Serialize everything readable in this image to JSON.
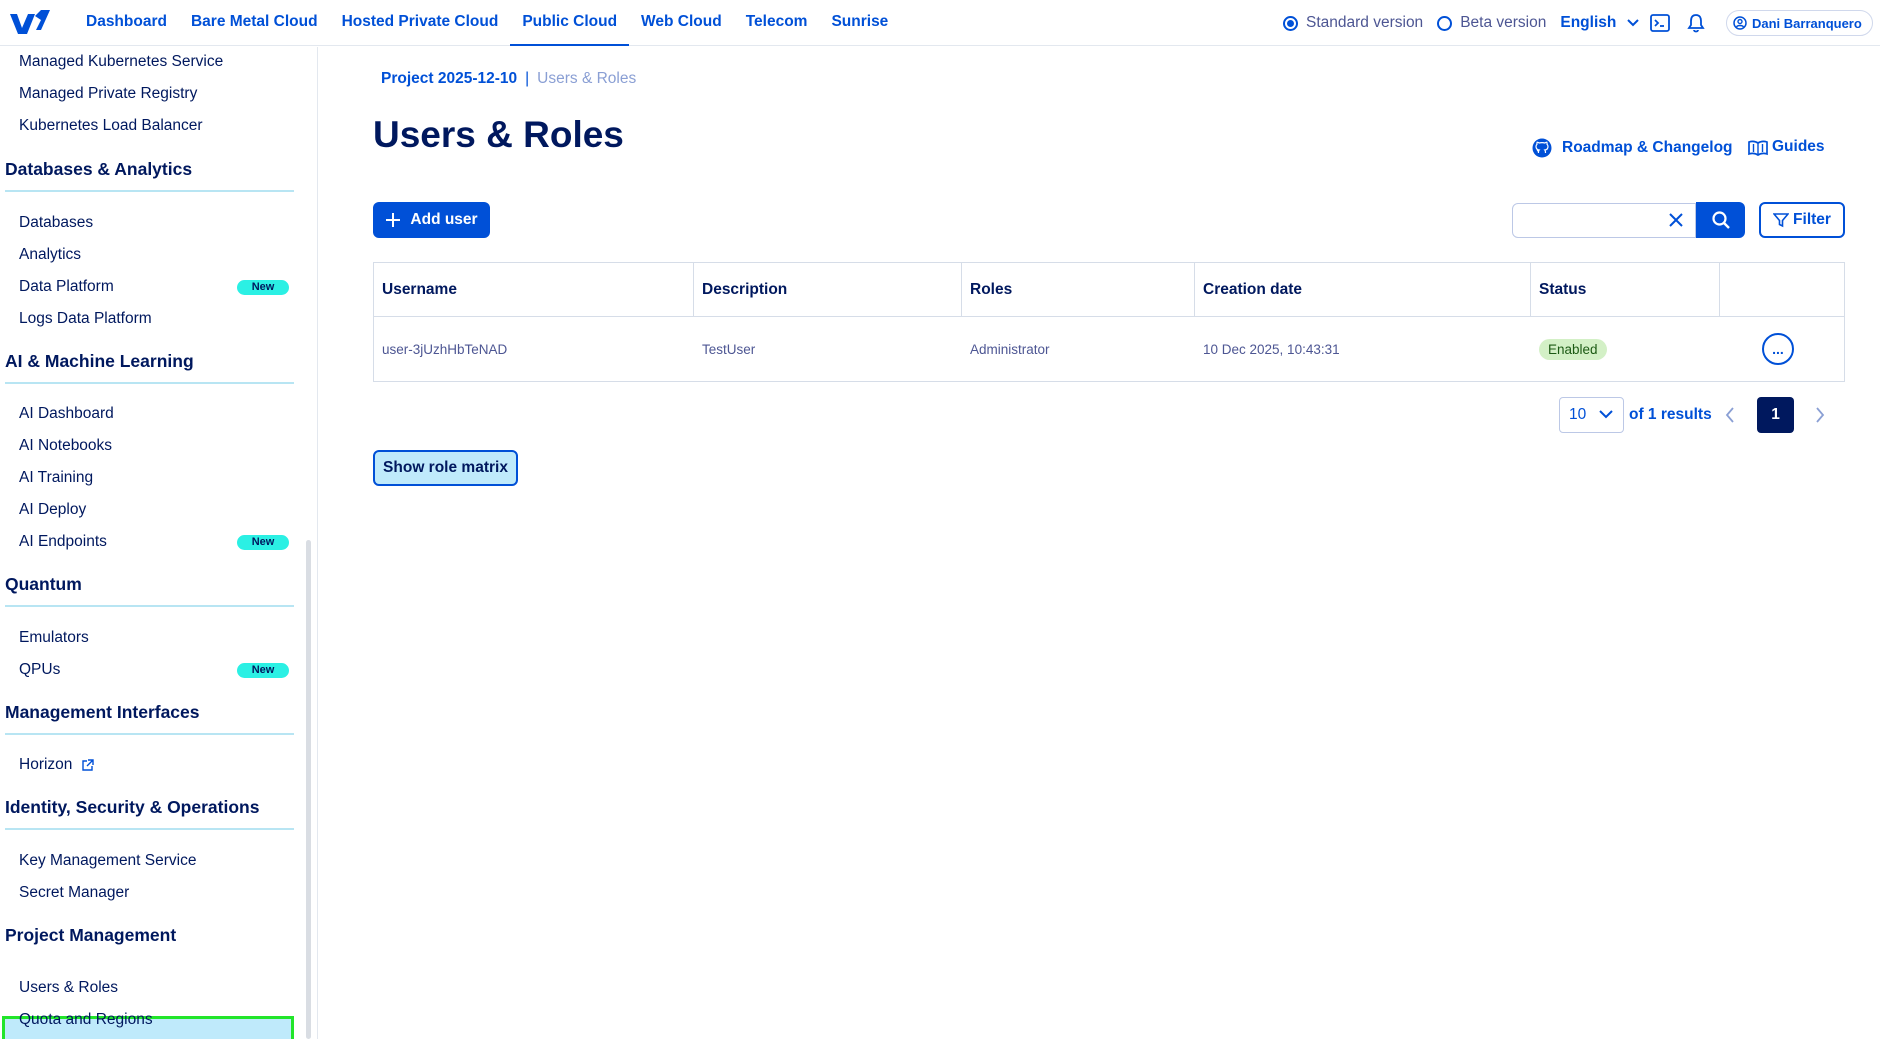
{
  "topbar": {
    "nav": [
      "Dashboard",
      "Bare Metal Cloud",
      "Hosted Private Cloud",
      "Public Cloud",
      "Web Cloud",
      "Telecom",
      "Sunrise"
    ],
    "version_standard": "Standard version",
    "version_beta": "Beta version",
    "language": "English",
    "user_name": "Dani Barranquero",
    "accent_color": "#0050d7"
  },
  "sidebar": {
    "items_top": [
      "Managed Kubernetes Service",
      "Managed Private Registry",
      "Kubernetes Load Balancer"
    ],
    "sections": {
      "db": {
        "title": "Databases & Analytics",
        "items": [
          "Databases",
          "Analytics",
          "Data Platform",
          "Logs Data Platform"
        ]
      },
      "ai": {
        "title": "AI & Machine Learning",
        "items": [
          "AI Dashboard",
          "AI Notebooks",
          "AI Training",
          "AI Deploy",
          "AI Endpoints"
        ]
      },
      "quantum": {
        "title": "Quantum",
        "items": [
          "Emulators",
          "QPUs"
        ]
      },
      "mgmt": {
        "title": "Management Interfaces",
        "items": [
          "Horizon"
        ]
      },
      "security": {
        "title": "Identity, Security & Operations",
        "items": [
          "Key Management Service",
          "Secret Manager"
        ]
      },
      "project": {
        "title": "Project Management",
        "items": [
          "Users & Roles",
          "Quota and Regions"
        ]
      }
    },
    "badge_new": "New"
  },
  "breadcrumb": {
    "project": "Project 2025-12-10",
    "separator": "|",
    "current": "Users & Roles"
  },
  "page": {
    "title": "Users & Roles",
    "roadmap_label": "Roadmap & Changelog",
    "guides_label": "Guides",
    "add_user_label": "Add user",
    "search_value": "",
    "filter_label": "Filter",
    "show_role_matrix_label": "Show role matrix"
  },
  "table": {
    "headers": [
      "Username",
      "Description",
      "Roles",
      "Creation date",
      "Status"
    ],
    "rows": [
      {
        "username": "user-3jUzhHbTeNAD",
        "description": "TestUser",
        "roles": "Administrator",
        "created": "10 Dec 2025, 10:43:31",
        "status": "Enabled",
        "actions": "..."
      }
    ]
  },
  "pagination": {
    "page_size": "10",
    "results": "of 1 results",
    "current_page": "1"
  }
}
